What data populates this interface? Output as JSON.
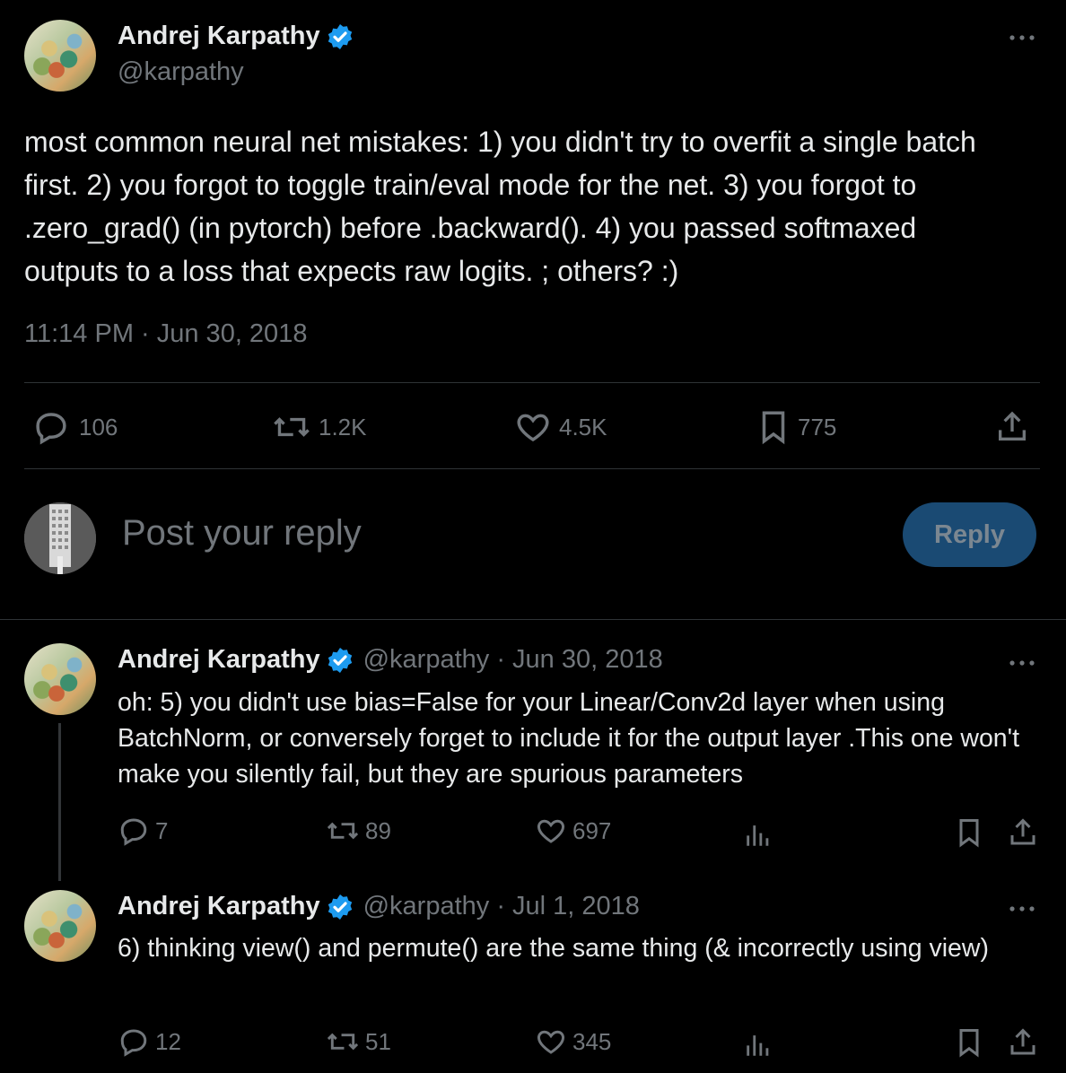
{
  "main_post": {
    "author_name": "Andrej Karpathy",
    "handle": "@karpathy",
    "text": "most common neural net mistakes: 1) you didn't try to overfit a single batch first. 2) you forgot to toggle train/eval mode for the net. 3) you forgot to .zero_grad() (in pytorch) before .backward(). 4) you passed softmaxed outputs to a loss that expects raw logits. ; others? :)",
    "timestamp": "11:14 PM · Jun 30, 2018",
    "replies": "106",
    "reposts": "1.2K",
    "likes": "4.5K",
    "bookmarks": "775"
  },
  "reply_box": {
    "placeholder": "Post your reply",
    "button_label": "Reply"
  },
  "thread": [
    {
      "author_name": "Andrej Karpathy",
      "meta": "@karpathy · Jun 30, 2018",
      "text": "oh: 5) you didn't use bias=False for your Linear/Conv2d layer when using BatchNorm, or conversely forget to include it for the output layer .This one won't make you silently fail, but they are spurious parameters",
      "replies": "7",
      "reposts": "89",
      "likes": "697"
    },
    {
      "author_name": "Andrej Karpathy",
      "meta": "@karpathy · Jul 1, 2018",
      "text": "6) thinking view() and permute() are the same thing (& incorrectly using view)",
      "replies": "12",
      "reposts": "51",
      "likes": "345"
    }
  ],
  "colors": {
    "background": "#000000",
    "text": "#e7e9ea",
    "muted": "#71767b",
    "verified": "#1d9bf0",
    "reply_button": "#1a4a73"
  }
}
